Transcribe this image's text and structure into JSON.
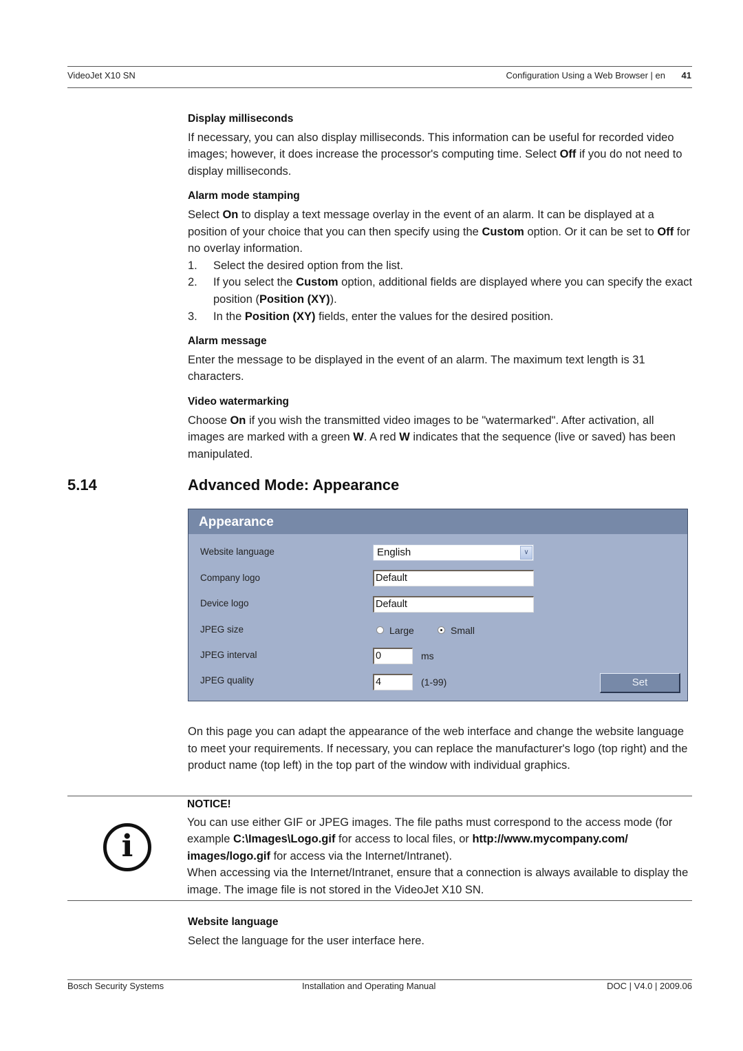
{
  "header": {
    "product": "VideoJet X10 SN",
    "chapter": "Configuration Using a Web Browser | en",
    "page_number": "41"
  },
  "sections_top": [
    {
      "heading": "Display milliseconds",
      "paragraph": [
        {
          "t": "If necessary, you can also display milliseconds. This information can be useful for recorded video images; however, it does increase the processor's computing time. Select "
        },
        {
          "b": "Off"
        },
        {
          "t": " if you do not need to display milliseconds."
        }
      ]
    },
    {
      "heading": "Alarm mode stamping",
      "paragraph": [
        {
          "t": "Select "
        },
        {
          "b": "On"
        },
        {
          "t": " to display a text message overlay in the event of an alarm. It can be displayed at a position of your choice that you can then specify using the "
        },
        {
          "b": "Custom"
        },
        {
          "t": " option. Or it can be set to "
        },
        {
          "b": "Off"
        },
        {
          "t": " for no overlay information."
        }
      ],
      "steps": [
        {
          "num": "1.",
          "parts": [
            {
              "t": "Select the desired option from the list."
            }
          ]
        },
        {
          "num": "2.",
          "parts": [
            {
              "t": "If you select the "
            },
            {
              "b": "Custom"
            },
            {
              "t": " option, additional fields are displayed where you can specify the exact position ("
            },
            {
              "b": "Position (XY)"
            },
            {
              "t": ")."
            }
          ]
        },
        {
          "num": "3.",
          "parts": [
            {
              "t": "In the "
            },
            {
              "b": "Position (XY)"
            },
            {
              "t": " fields, enter the values for the desired position."
            }
          ]
        }
      ]
    },
    {
      "heading": "Alarm message",
      "paragraph": [
        {
          "t": "Enter the message to be displayed in the event of an alarm. The maximum text length is 31 characters."
        }
      ]
    },
    {
      "heading": "Video watermarking",
      "paragraph": [
        {
          "t": "Choose "
        },
        {
          "b": "On"
        },
        {
          "t": " if you wish the transmitted video images to be \"watermarked\". After activation, all images are marked with a green "
        },
        {
          "b": "W"
        },
        {
          "t": ". A red "
        },
        {
          "b": "W"
        },
        {
          "t": " indicates that the sequence (live or saved) has been manipulated."
        }
      ]
    }
  ],
  "section": {
    "number": "5.14",
    "title": "Advanced Mode: Appearance"
  },
  "panel": {
    "title": "Appearance",
    "website_language_label": "Website language",
    "website_language_value": "English",
    "company_logo_label": "Company logo",
    "company_logo_value": "Default",
    "device_logo_label": "Device logo",
    "device_logo_value": "Default",
    "jpeg_size_label": "JPEG size",
    "jpeg_size_options": [
      "Large",
      "Small"
    ],
    "jpeg_size_selected": "Small",
    "jpeg_interval_label": "JPEG interval",
    "jpeg_interval_value": "0",
    "jpeg_interval_unit": "ms",
    "jpeg_quality_label": "JPEG quality",
    "jpeg_quality_value": "4",
    "jpeg_quality_range": "(1-99)",
    "set_button": "Set",
    "colors": {
      "panel_bg": "#a3b1cc",
      "header_bg": "#7789a8"
    }
  },
  "intro_paragraph": "On this page you can adapt the appearance of the web interface and change the website language to meet your requirements. If necessary, you can replace the manufacturer's logo (top right) and the product name (top left) in the top part of the window with individual graphics.",
  "notice": {
    "icon": "info-icon",
    "heading": "NOTICE!",
    "paragraph1": [
      {
        "t": "You can use either GIF or JPEG images. The file paths must correspond to the access mode (for example "
      },
      {
        "b": "C:\\Images\\Logo.gif"
      },
      {
        "t": " for access to local files, or "
      },
      {
        "b": "http://www.mycompany.com/ images/logo.gif"
      },
      {
        "t": " for access via the Internet/Intranet)."
      }
    ],
    "paragraph2": "When accessing via the Internet/Intranet, ensure that a connection is always available to display the image. The image file is not stored in the VideoJet X10 SN."
  },
  "website_language_section": {
    "heading": "Website language",
    "text": "Select the language for the user interface here."
  },
  "footer": {
    "company": "Bosch Security Systems",
    "manual": "Installation and Operating Manual",
    "doc": "DOC | V4.0 | 2009.06"
  }
}
